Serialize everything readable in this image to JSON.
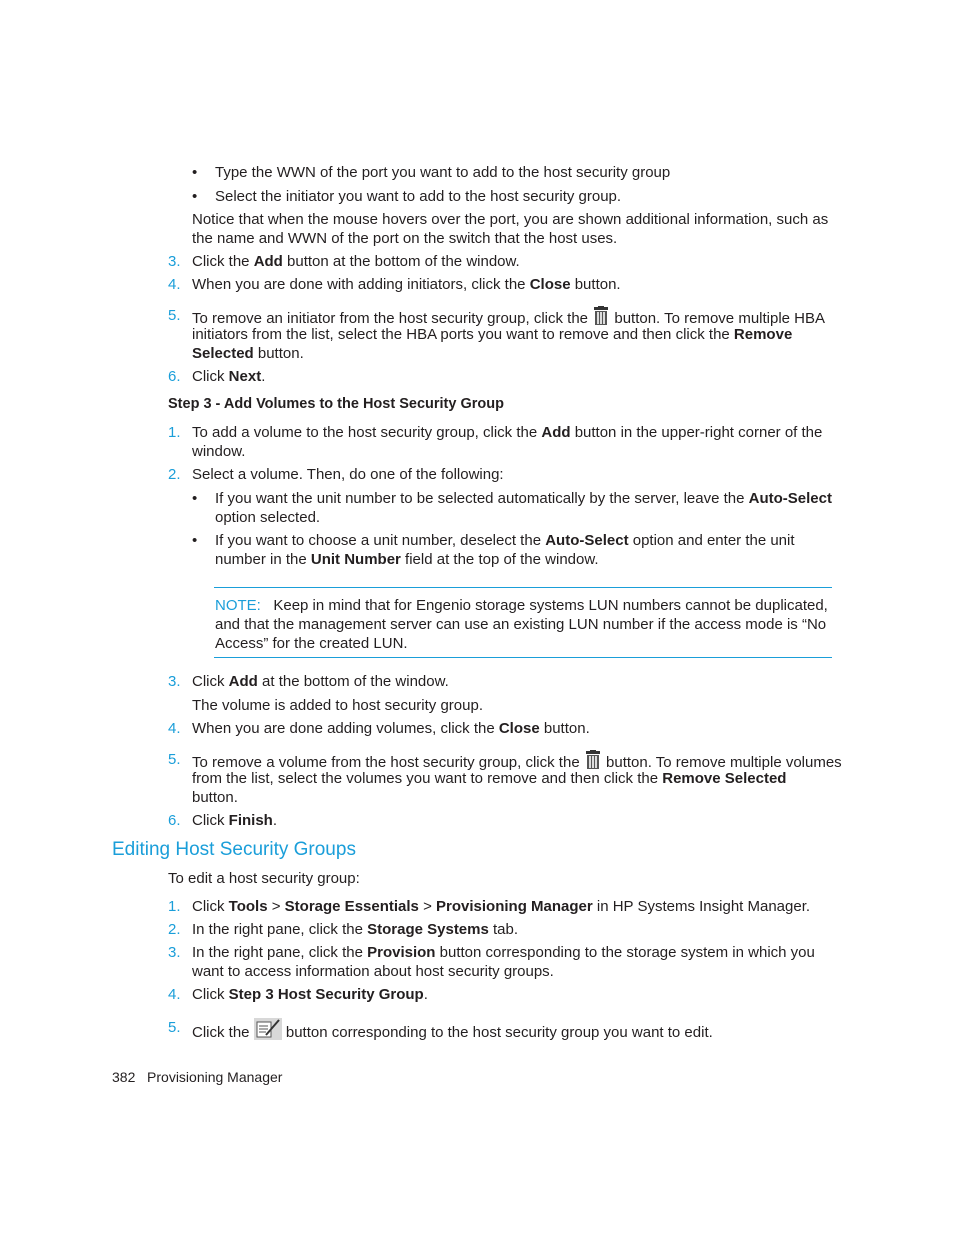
{
  "page": {
    "top_bullets": [
      "Type the WWN of the port you want to add to the host security group",
      "Select the initiator you want to add to the host security group."
    ],
    "notice_lines": [
      "Notice that when the mouse hovers over the port, you are shown additional information, such as",
      "the name and WWN of the port on the switch that the host uses."
    ],
    "step2_items": [
      {
        "num": "3.",
        "pre": "Click the ",
        "bold": "Add",
        "post": " button at the bottom of the window."
      },
      {
        "num": "4.",
        "pre": "When you are done with adding initiators, click the ",
        "bold": "Close",
        "post": " button."
      },
      {
        "num": "5.",
        "line1_pre": "To remove an initiator from the host security group, click the ",
        "icon": "trash-icon",
        "line1_post": " button. To remove multiple HBA",
        "line2_pre": "initiators from the list, select the HBA ports you want to remove and then click the ",
        "line2_bold": "Remove",
        "line3_bold": "Selected",
        "line3_post": " button."
      },
      {
        "num": "6.",
        "pre": "Click ",
        "bold": "Next",
        "post": "."
      }
    ],
    "step3_heading": "Step 3 - Add Volumes to the Host Security Group",
    "step3_items": [
      {
        "num": "1.",
        "line1_pre": "To add a volume to the host security group, click the ",
        "line1_bold": "Add",
        "line1_post": " button in the upper-right corner of the",
        "line2": "window."
      },
      {
        "num": "2.",
        "text": "Select a volume. Then, do one of the following:"
      }
    ],
    "step3_bullets": [
      {
        "line1_pre": "If you want the unit number to be selected automatically by the server, leave the ",
        "line1_bold": "Auto-Select",
        "line2": "option selected."
      },
      {
        "line1_pre": "If you want to choose a unit number, deselect the ",
        "line1_bold": "Auto-Select",
        "line1_post": " option and enter the unit",
        "line2_pre": "number in the ",
        "line2_bold": "Unit Number",
        "line2_post": " field at the top of the window."
      }
    ],
    "note": {
      "label": "NOTE:",
      "lines": [
        "Keep in mind that for Engenio storage systems LUN numbers cannot be duplicated,",
        "and that the management server can use an existing LUN number if the access mode is “No",
        "Access” for the created LUN."
      ]
    },
    "step3_items_b": [
      {
        "num": "3.",
        "pre": "Click ",
        "bold": "Add",
        "post": " at the bottom of the window.",
        "sub": "The volume is added to host security group."
      },
      {
        "num": "4.",
        "pre": "When you are done adding volumes, click the ",
        "bold": "Close",
        "post": " button."
      },
      {
        "num": "5.",
        "line1_pre": "To remove a volume from the host security group, click the ",
        "icon": "trash-icon",
        "line1_post": " button. To remove multiple volumes",
        "line2_pre": "from the list, select the volumes you want to remove and then click the ",
        "line2_bold": "Remove Selected",
        "line3": "button."
      },
      {
        "num": "6.",
        "pre": "Click ",
        "bold": "Finish",
        "post": "."
      }
    ],
    "section_title": "Editing Host Security Groups",
    "edit_intro": "To edit a host security group:",
    "edit_items": [
      {
        "num": "1.",
        "pre": "Click ",
        "b1": "Tools",
        "s1": " > ",
        "b2": "Storage Essentials",
        "s2": " > ",
        "b3": "Provisioning Manager",
        "post": " in HP Systems Insight Manager."
      },
      {
        "num": "2.",
        "pre": "In the right pane, click the ",
        "bold": "Storage Systems",
        "post": " tab."
      },
      {
        "num": "3.",
        "line1_pre": "In the right pane, click the ",
        "line1_bold": "Provision",
        "line1_post": " button corresponding to the storage system in which you",
        "line2": "want to access information about host security groups."
      },
      {
        "num": "4.",
        "pre": "Click ",
        "bold": "Step 3 Host Security Group",
        "post": "."
      },
      {
        "num": "5.",
        "pre": "Click the ",
        "icon": "edit-icon",
        "post": " button corresponding to the host security group you want to edit."
      }
    ],
    "footer": {
      "page_number": "382",
      "chapter": "Provisioning Manager"
    },
    "colors": {
      "accent": "#1a9ed9",
      "text": "#231f20"
    }
  }
}
